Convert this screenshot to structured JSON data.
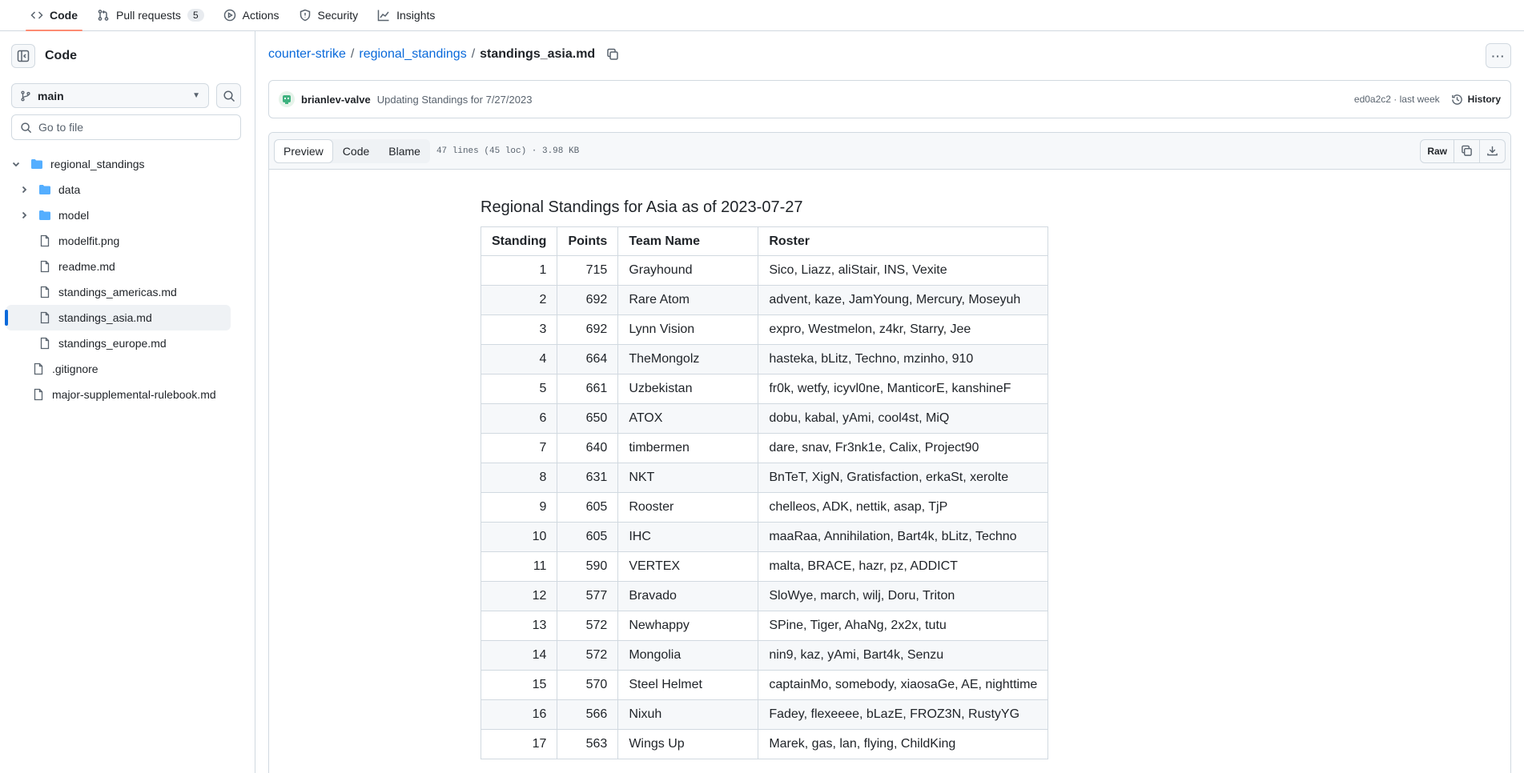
{
  "repo_nav": {
    "tabs": [
      {
        "label": "Code",
        "icon": "code-icon",
        "active": true
      },
      {
        "label": "Pull requests",
        "icon": "pull-request-icon",
        "count": "5"
      },
      {
        "label": "Actions",
        "icon": "play-icon"
      },
      {
        "label": "Security",
        "icon": "shield-icon"
      },
      {
        "label": "Insights",
        "icon": "graph-icon"
      }
    ]
  },
  "sidebar": {
    "title": "Code",
    "branch": "main",
    "goto_placeholder": "Go to file",
    "tree": [
      {
        "label": "regional_standings",
        "type": "folder-open",
        "expanded": true
      },
      {
        "label": "data",
        "type": "folder"
      },
      {
        "label": "model",
        "type": "folder"
      },
      {
        "label": "modelfit.png",
        "type": "file"
      },
      {
        "label": "readme.md",
        "type": "file"
      },
      {
        "label": "standings_americas.md",
        "type": "file"
      },
      {
        "label": "standings_asia.md",
        "type": "file",
        "selected": true
      },
      {
        "label": "standings_europe.md",
        "type": "file"
      },
      {
        "label": ".gitignore",
        "type": "file"
      },
      {
        "label": "major-supplemental-rulebook.md",
        "type": "file"
      }
    ]
  },
  "breadcrumb": {
    "repo": "counter-strike",
    "folder": "regional_standings",
    "file": "standings_asia.md",
    "separator": "/"
  },
  "commit": {
    "author": "brianlev-valve",
    "message": "Updating Standings for 7/27/2023",
    "hash": "ed0a2c2",
    "time": "last week",
    "separator": "·",
    "history_label": "History"
  },
  "file_view": {
    "tabs": [
      "Preview",
      "Code",
      "Blame"
    ],
    "active_tab": "Preview",
    "meta": "47 lines (45 loc) · 3.98 KB",
    "raw_label": "Raw"
  },
  "content": {
    "heading": "Regional Standings for Asia as of 2023-07-27",
    "columns": [
      "Standing",
      "Points",
      "Team Name",
      "Roster"
    ],
    "rows": [
      [
        "1",
        "715",
        "Grayhound",
        "Sico, Liazz, aliStair, INS, Vexite"
      ],
      [
        "2",
        "692",
        "Rare Atom",
        "advent, kaze, JamYoung, Mercury, Moseyuh"
      ],
      [
        "3",
        "692",
        "Lynn Vision",
        "expro, Westmelon, z4kr, Starry, Jee"
      ],
      [
        "4",
        "664",
        "TheMongolz",
        "hasteka, bLitz, Techno, mzinho, 910"
      ],
      [
        "5",
        "661",
        "Uzbekistan",
        "fr0k, wetfy, icyvl0ne, ManticorE, kanshineF"
      ],
      [
        "6",
        "650",
        "ATOX",
        "dobu, kabal, yAmi, cool4st, MiQ"
      ],
      [
        "7",
        "640",
        "timbermen",
        "dare, snav, Fr3nk1e, Calix, Project90"
      ],
      [
        "8",
        "631",
        "NKT",
        "BnTeT, XigN, Gratisfaction, erkaSt, xerolte"
      ],
      [
        "9",
        "605",
        "Rooster",
        "chelleos, ADK, nettik, asap, TjP"
      ],
      [
        "10",
        "605",
        "IHC",
        "maaRaa, Annihilation, Bart4k, bLitz, Techno"
      ],
      [
        "11",
        "590",
        "VERTEX",
        "malta, BRACE, hazr, pz, ADDICT"
      ],
      [
        "12",
        "577",
        "Bravado",
        "SloWye, march, wilj, Doru, Triton"
      ],
      [
        "13",
        "572",
        "Newhappy",
        "SPine, Tiger, AhaNg, 2x2x, tutu"
      ],
      [
        "14",
        "572",
        "Mongolia",
        "nin9, kaz, yAmi, Bart4k, Senzu"
      ],
      [
        "15",
        "570",
        "Steel Helmet",
        "captainMo, somebody, xiaosaGe, AE, nighttime"
      ],
      [
        "16",
        "566",
        "Nixuh",
        "Fadey, flexeeee, bLazE, FROZ3N, RustyYG"
      ],
      [
        "17",
        "563",
        "Wings Up",
        "Marek, gas, lan, flying, ChildKing"
      ]
    ]
  },
  "colors": {
    "link": "#0969da",
    "active_tab_underline": "#fd8c73",
    "border": "#d1d9e0",
    "muted_text": "#59636e",
    "folder": "#54aeff"
  }
}
